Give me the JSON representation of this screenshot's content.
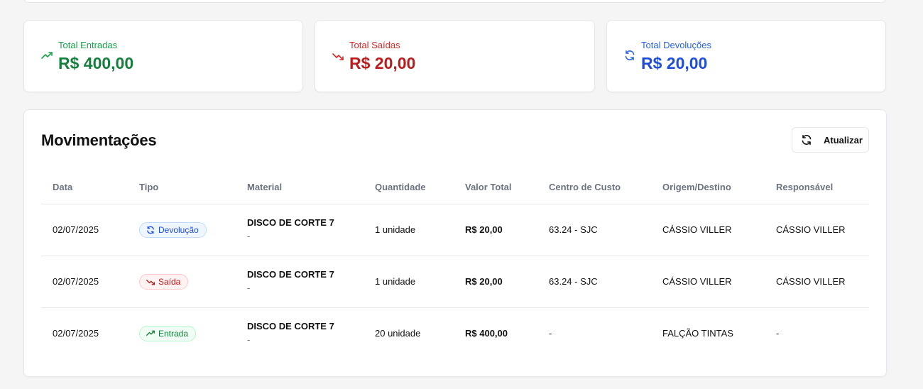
{
  "stats": {
    "entradas": {
      "label": "Total Entradas",
      "value": "R$ 400,00",
      "icon": "trending-up-icon",
      "color": "#15803d"
    },
    "saidas": {
      "label": "Total Saídas",
      "value": "R$ 20,00",
      "icon": "trending-down-icon",
      "color": "#b91c1c"
    },
    "devolucoes": {
      "label": "Total Devoluções",
      "value": "R$ 20,00",
      "icon": "refresh-icon",
      "color": "#1d4ed8"
    }
  },
  "movements": {
    "title": "Movimentações",
    "refresh_label": "Atualizar",
    "columns": [
      "Data",
      "Tipo",
      "Material",
      "Quantidade",
      "Valor Total",
      "Centro de Custo",
      "Origem/Destino",
      "Responsável"
    ],
    "rows": [
      {
        "data": "02/07/2025",
        "tipo": "Devolução",
        "material": "DISCO DE CORTE 7",
        "material_sub": "-",
        "quantidade": "1 unidade",
        "valor": "R$ 20,00",
        "centro": "63.24 - SJC",
        "origem": "CÁSSIO VILLER",
        "responsavel": "CÁSSIO VILLER"
      },
      {
        "data": "02/07/2025",
        "tipo": "Saída",
        "material": "DISCO DE CORTE 7",
        "material_sub": "-",
        "quantidade": "1 unidade",
        "valor": "R$ 20,00",
        "centro": "63.24 - SJC",
        "origem": "CÁSSIO VILLER",
        "responsavel": "CÁSSIO VILLER"
      },
      {
        "data": "02/07/2025",
        "tipo": "Entrada",
        "material": "DISCO DE CORTE 7",
        "material_sub": "-",
        "quantidade": "20 unidade",
        "valor": "R$ 400,00",
        "centro": "-",
        "origem": "FALÇÃO TINTAS",
        "responsavel": "-"
      }
    ]
  }
}
